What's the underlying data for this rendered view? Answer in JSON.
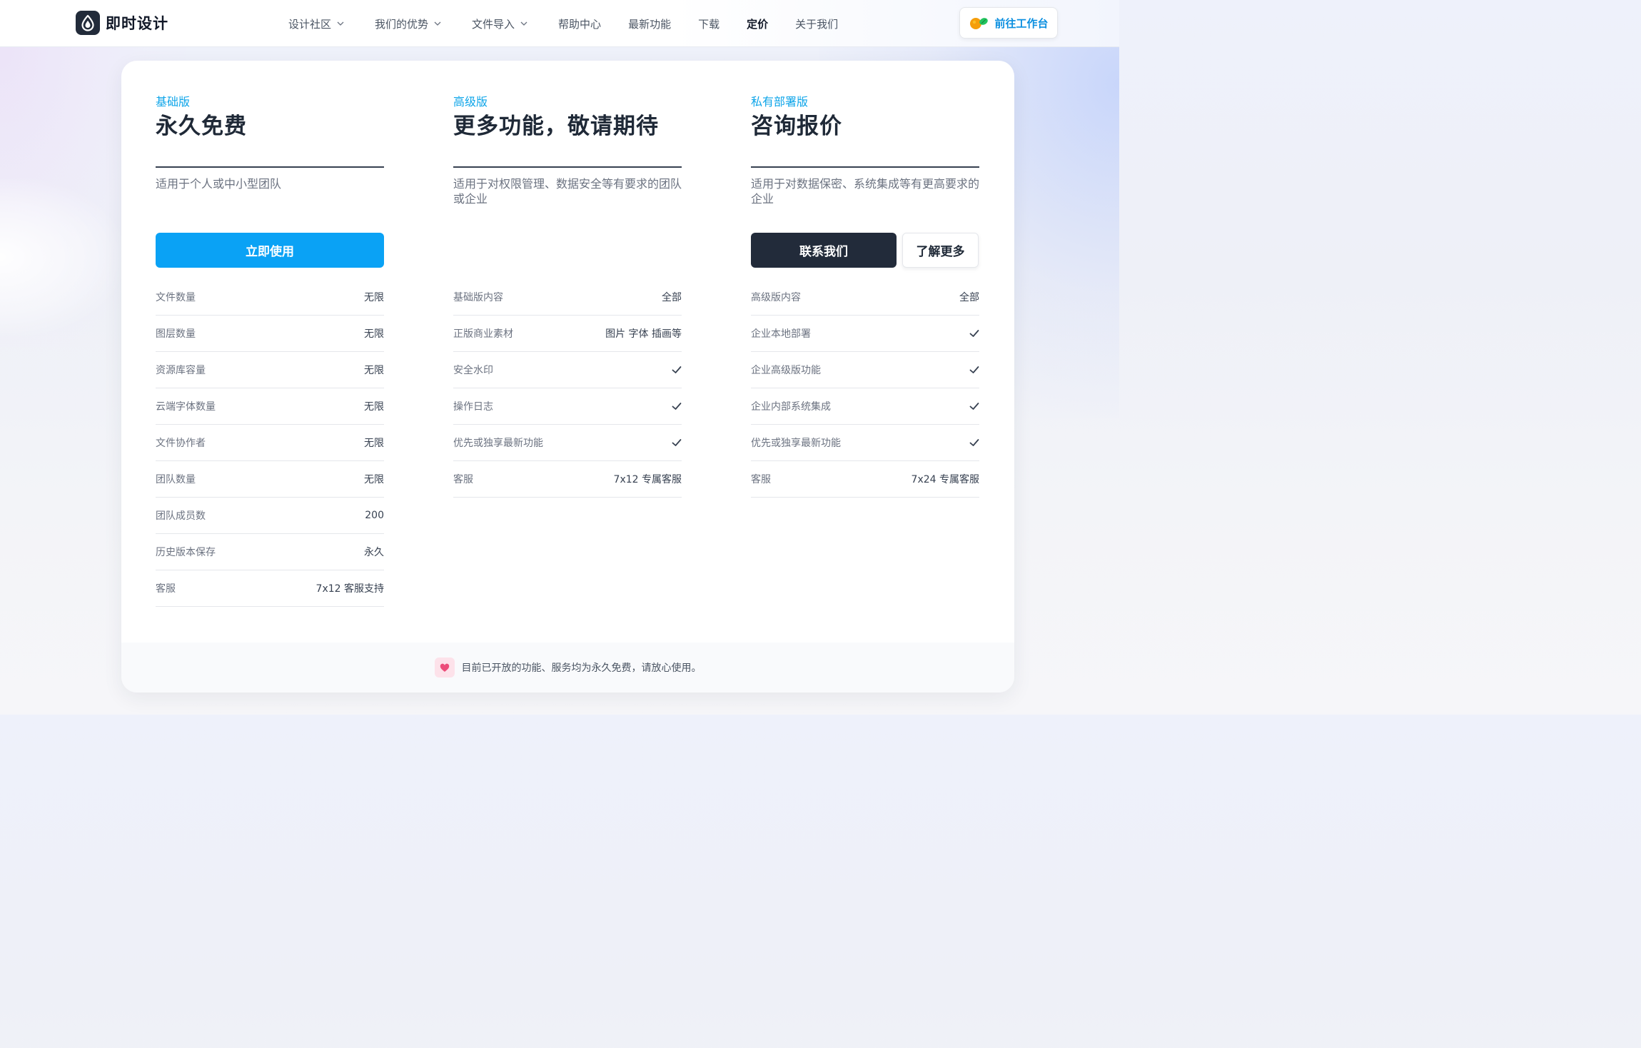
{
  "header": {
    "logo_text": "即时设计",
    "nav": [
      {
        "label": "设计社区",
        "dropdown": true
      },
      {
        "label": "我们的优势",
        "dropdown": true
      },
      {
        "label": "文件导入",
        "dropdown": true
      },
      {
        "label": "帮助中心",
        "dropdown": false
      },
      {
        "label": "最新功能",
        "dropdown": false
      },
      {
        "label": "下载",
        "dropdown": false
      },
      {
        "label": "定价",
        "dropdown": false,
        "active": true
      },
      {
        "label": "关于我们",
        "dropdown": false
      }
    ],
    "cta_label": "前往工作台"
  },
  "plans": [
    {
      "tier": "基础版",
      "title": "永久免费",
      "description": "适用于个人或中小型团队",
      "primary_button": "立即使用",
      "features": [
        {
          "label": "文件数量",
          "value": "无限"
        },
        {
          "label": "图层数量",
          "value": "无限"
        },
        {
          "label": "资源库容量",
          "value": "无限"
        },
        {
          "label": "云端字体数量",
          "value": "无限"
        },
        {
          "label": "文件协作者",
          "value": "无限"
        },
        {
          "label": "团队数量",
          "value": "无限"
        },
        {
          "label": "团队成员数",
          "value": "200"
        },
        {
          "label": "历史版本保存",
          "value": "永久"
        },
        {
          "label": "客服",
          "value": "7x12 客服支持"
        }
      ]
    },
    {
      "tier": "高级版",
      "title": "更多功能，敬请期待",
      "description": "适用于对权限管理、数据安全等有要求的团队或企业",
      "features": [
        {
          "label": "基础版内容",
          "value": "全部"
        },
        {
          "label": "正版商业素材",
          "value": "图片 字体 插画等"
        },
        {
          "label": "安全水印",
          "value": "check"
        },
        {
          "label": "操作日志",
          "value": "check"
        },
        {
          "label": "优先或独享最新功能",
          "value": "check"
        },
        {
          "label": "客服",
          "value": "7x12 专属客服"
        }
      ]
    },
    {
      "tier": "私有部署版",
      "title": "咨询报价",
      "description": "适用于对数据保密、系统集成等有更高要求的企业",
      "primary_button": "联系我们",
      "secondary_button": "了解更多",
      "features": [
        {
          "label": "高级版内容",
          "value": "全部"
        },
        {
          "label": "企业本地部署",
          "value": "check"
        },
        {
          "label": "企业高级版功能",
          "value": "check"
        },
        {
          "label": "企业内部系统集成",
          "value": "check"
        },
        {
          "label": "优先或独享最新功能",
          "value": "check"
        },
        {
          "label": "客服",
          "value": "7x24 专属客服"
        }
      ]
    }
  ],
  "footer": {
    "icon": "heart-icon",
    "text": "目前已开放的功能、服务均为永久免费，请放心使用。"
  },
  "colors": {
    "accent": "#0aa2f5",
    "tier_label": "#0ea5e9",
    "dark_button": "#222b3a",
    "heart": "#ec4d7a"
  }
}
